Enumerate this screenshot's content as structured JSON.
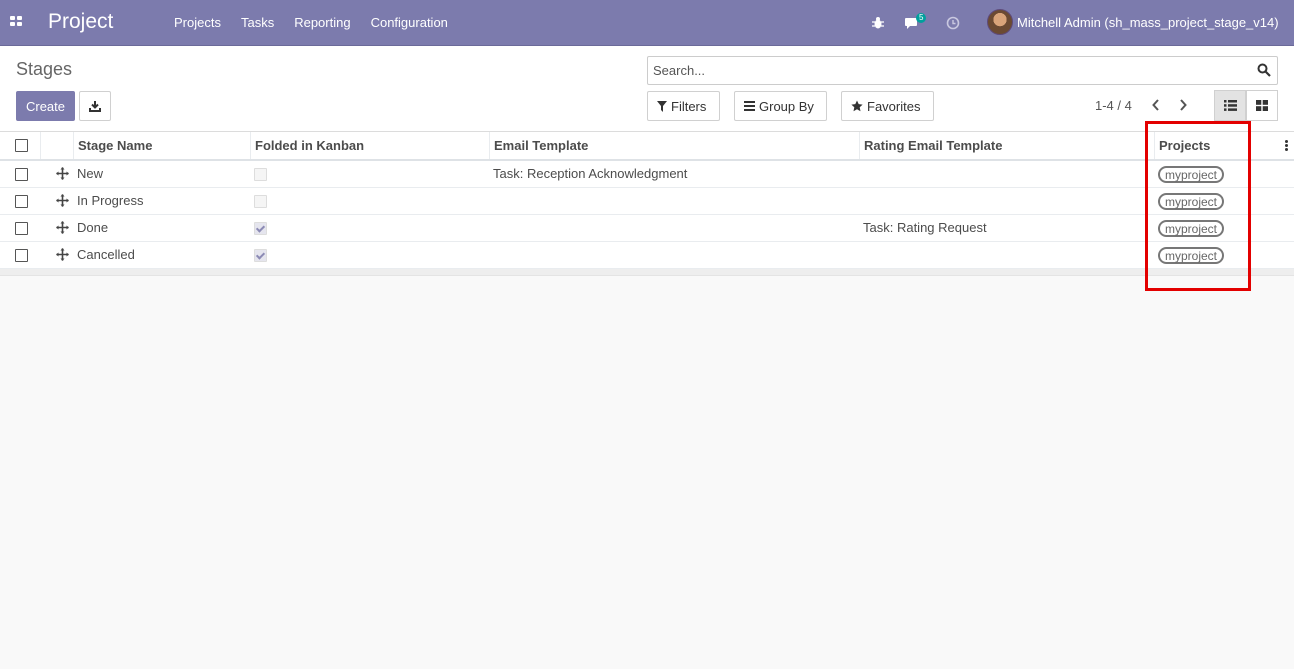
{
  "navbar": {
    "app_title": "Project",
    "menu": [
      "Projects",
      "Tasks",
      "Reporting",
      "Configuration"
    ],
    "messages_count": "5",
    "user_name": "Mitchell Admin (sh_mass_project_stage_v14)",
    "color": "#7c7bad"
  },
  "control_panel": {
    "page_title": "Stages",
    "create_label": "Create",
    "search_placeholder": "Search...",
    "filters_label": "Filters",
    "group_by_label": "Group By",
    "favorites_label": "Favorites",
    "pager": "1-4 / 4"
  },
  "table": {
    "headers": [
      "Stage Name",
      "Folded in Kanban",
      "Email Template",
      "Rating Email Template",
      "Projects"
    ],
    "rows": [
      {
        "name": "New",
        "folded": false,
        "email_template": "Task: Reception Acknowledgment",
        "rating_template": "",
        "project": "myproject"
      },
      {
        "name": "In Progress",
        "folded": false,
        "email_template": "",
        "rating_template": "",
        "project": "myproject"
      },
      {
        "name": "Done",
        "folded": true,
        "email_template": "",
        "rating_template": "Task: Rating Request",
        "project": "myproject"
      },
      {
        "name": "Cancelled",
        "folded": true,
        "email_template": "",
        "rating_template": "",
        "project": "myproject"
      }
    ]
  },
  "annotation": {
    "highlight_color": "#e30000"
  }
}
